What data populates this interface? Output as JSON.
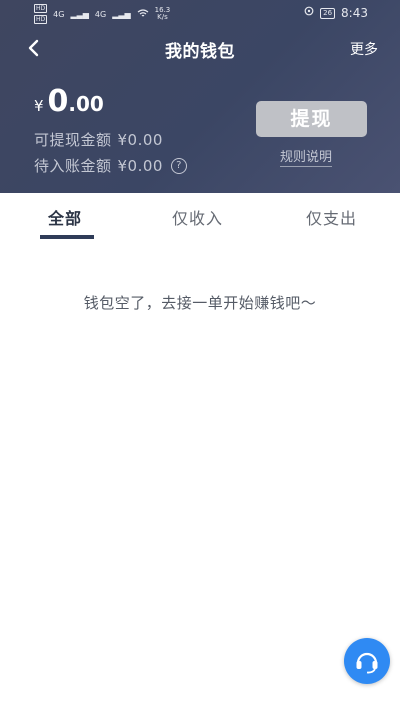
{
  "status_bar": {
    "net_left_1": "HD",
    "net_left_2": "HD",
    "signal_1": "4G",
    "signal_2": "4G",
    "speed_value": "16.3",
    "speed_unit": "K/s",
    "battery": "26",
    "time": "8:43"
  },
  "navbar": {
    "title": "我的钱包",
    "more_label": "更多"
  },
  "wallet": {
    "currency_symbol": "¥",
    "balance_int": "0",
    "balance_dec": ".00",
    "withdrawable_label": "可提现金额",
    "withdrawable_value": "¥0.00",
    "pending_label": "待入账金额",
    "pending_value": "¥0.00",
    "help_glyph": "?",
    "withdraw_button": "提现",
    "rules_link": "规则说明"
  },
  "tabs": [
    {
      "label": "全部",
      "active": true
    },
    {
      "label": "仅收入",
      "active": false
    },
    {
      "label": "仅支出",
      "active": false
    }
  ],
  "empty_message": "钱包空了，去接一单开始赚钱吧～",
  "colors": {
    "header_bg": "#3f4660",
    "accent_indicator": "#2f3c58",
    "withdraw_disabled": "#bfc1c6",
    "cs_button": "#2f8af3"
  },
  "icons": {
    "back": "back-arrow-icon",
    "help": "question-circle-icon",
    "customer_service": "headset-icon"
  }
}
